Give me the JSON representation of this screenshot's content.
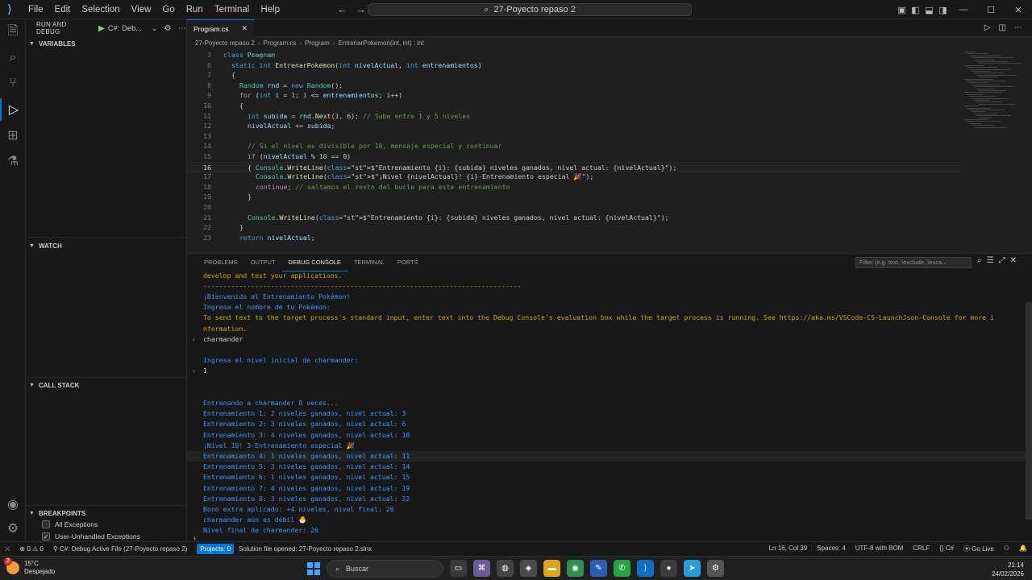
{
  "titlebar": {
    "menu": [
      "File",
      "Edit",
      "Selection",
      "View",
      "Go",
      "Run",
      "Terminal",
      "Help"
    ],
    "search_text": "27-Poyecto repaso 2"
  },
  "sidebar": {
    "run_and_debug": "RUN AND DEBUG",
    "config": "C#: Deb...",
    "variables": "VARIABLES",
    "watch": "WATCH",
    "call_stack": "CALL STACK",
    "breakpoints": "BREAKPOINTS",
    "bp_items": [
      {
        "label": "All Exceptions",
        "checked": false
      },
      {
        "label": "User-Unhandled Exceptions",
        "checked": true
      }
    ]
  },
  "editor": {
    "tab_label": "Program.cs",
    "breadcrumbs": [
      "27-Poyecto repaso 2",
      "Program.cs",
      "Program",
      "EntrenarPokemon(int, int) : int"
    ],
    "ref_hint": "1 reference",
    "lines": [
      {
        "n": "3",
        "text": "class Program"
      },
      {
        "n": "6",
        "text": "static int EntrenarPokemon(int nivelActual, int entrenamientos)"
      },
      {
        "n": "7",
        "text": "{"
      },
      {
        "n": "8",
        "text": "Random rnd = new Random();"
      },
      {
        "n": "9",
        "text": "for (int i = 1; i <= entrenamientos; i++)"
      },
      {
        "n": "10",
        "text": "{"
      },
      {
        "n": "11",
        "text": "int subida = rnd.Next(1, 6); // Sube entre 1 y 5 niveles"
      },
      {
        "n": "12",
        "text": "nivelActual += subida;"
      },
      {
        "n": "13",
        "text": ""
      },
      {
        "n": "14",
        "text": "// Si el nivel es divisible por 10, mensaje especial y continuar"
      },
      {
        "n": "15",
        "text": "if (nivelActual % 10 == 0)"
      },
      {
        "n": "16",
        "text": "{ Console.WriteLine($\"Entrenamiento {i}: {subida} niveles ganados, nivel actual: {nivelActual}\");"
      },
      {
        "n": "17",
        "text": "Console.WriteLine($\"¡Nivel {nivelActual}! {i}-Entrenamiento especial 🎉\");"
      },
      {
        "n": "18",
        "text": "continue; // saltamos el resto del bucle para este entrenamiento"
      },
      {
        "n": "19",
        "text": "}"
      },
      {
        "n": "20",
        "text": ""
      },
      {
        "n": "21",
        "text": "Console.WriteLine($\"Entrenamiento {i}: {subida} niveles ganados, nivel actual: {nivelActual}\");"
      },
      {
        "n": "22",
        "text": "}"
      },
      {
        "n": "23",
        "text": "return nivelActual;"
      }
    ]
  },
  "panel": {
    "tabs": [
      "PROBLEMS",
      "OUTPUT",
      "DEBUG CONSOLE",
      "TERMINAL",
      "PORTS"
    ],
    "filter_placeholder": "Filter (e.g. text, !exclude, \\esca...",
    "console": [
      {
        "kind": "warn",
        "text": "develop and test your applications."
      },
      {
        "kind": "warn",
        "text": "--------------------------------------------------------------------------------"
      },
      {
        "kind": "out",
        "text": "¡Bienvenido al Entrenamiento Pokémon!"
      },
      {
        "kind": "out",
        "text": "Ingresa el nombre de tu Pokémon:"
      },
      {
        "kind": "warn",
        "text": "To send text to the target process's standard input, enter text into the Debug Console's evaluation box while the target process is running. See https://aka.ms/VSCode-CS-LaunchJson-Console for more i"
      },
      {
        "kind": "warn",
        "text": "nformation."
      },
      {
        "kind": "inp",
        "text": "charmander"
      },
      {
        "kind": "blank",
        "text": ""
      },
      {
        "kind": "out",
        "text": "Ingresa el nivel inicial de charmander:"
      },
      {
        "kind": "inp",
        "text": "1"
      },
      {
        "kind": "blank",
        "text": ""
      },
      {
        "kind": "blank",
        "text": ""
      },
      {
        "kind": "out",
        "text": "Entrenando a charmander 8 veces..."
      },
      {
        "kind": "out",
        "text": "Entrenamiento 1: 2 niveles ganados, nivel actual: 3"
      },
      {
        "kind": "out",
        "text": "Entrenamiento 2: 3 niveles ganados, nivel actual: 6"
      },
      {
        "kind": "out",
        "text": "Entrenamiento 3: 4 niveles ganados, nivel actual: 10"
      },
      {
        "kind": "out",
        "text": "¡Nivel 10! 3-Entrenamiento especial 🎉"
      },
      {
        "kind": "out",
        "text": "Entrenamiento 4: 1 niveles ganados, nivel actual: 11"
      },
      {
        "kind": "out",
        "text": "Entrenamiento 5: 3 niveles ganados, nivel actual: 14"
      },
      {
        "kind": "out",
        "text": "Entrenamiento 6: 1 niveles ganados, nivel actual: 15"
      },
      {
        "kind": "out",
        "text": "Entrenamiento 7: 4 niveles ganados, nivel actual: 19"
      },
      {
        "kind": "out",
        "text": "Entrenamiento 8: 3 niveles ganados, nivel actual: 22"
      },
      {
        "kind": "out",
        "text": "Bono extra aplicado: +4 niveles, nivel final: 26"
      },
      {
        "kind": "out",
        "text": "charmander aún es débil 🐣"
      },
      {
        "kind": "out",
        "text": "Nivel final de charmander: 26"
      }
    ]
  },
  "statusbar": {
    "errors": "0",
    "warnings": "0",
    "debug": "C#: Debug Active File (27-Poyecto repaso 2)",
    "projects": "Projects: 0",
    "solution": "Solution file opened: 27-Poyecto repaso 2.slnx",
    "position": "Ln 16, Col 39",
    "spaces": "Spaces: 4",
    "encoding": "UTF-8 with BOM",
    "eol": "CRLF",
    "language": "C#",
    "golive": "Go Live"
  },
  "taskbar": {
    "temp": "15°C",
    "weather": "Despejado",
    "badge": "2",
    "search": "Buscar",
    "time": "21:14",
    "date": "24/02/2026"
  },
  "colors": {
    "accent": "#0078d4",
    "console_blue": "#3794ff",
    "console_yellow": "#cca700"
  }
}
